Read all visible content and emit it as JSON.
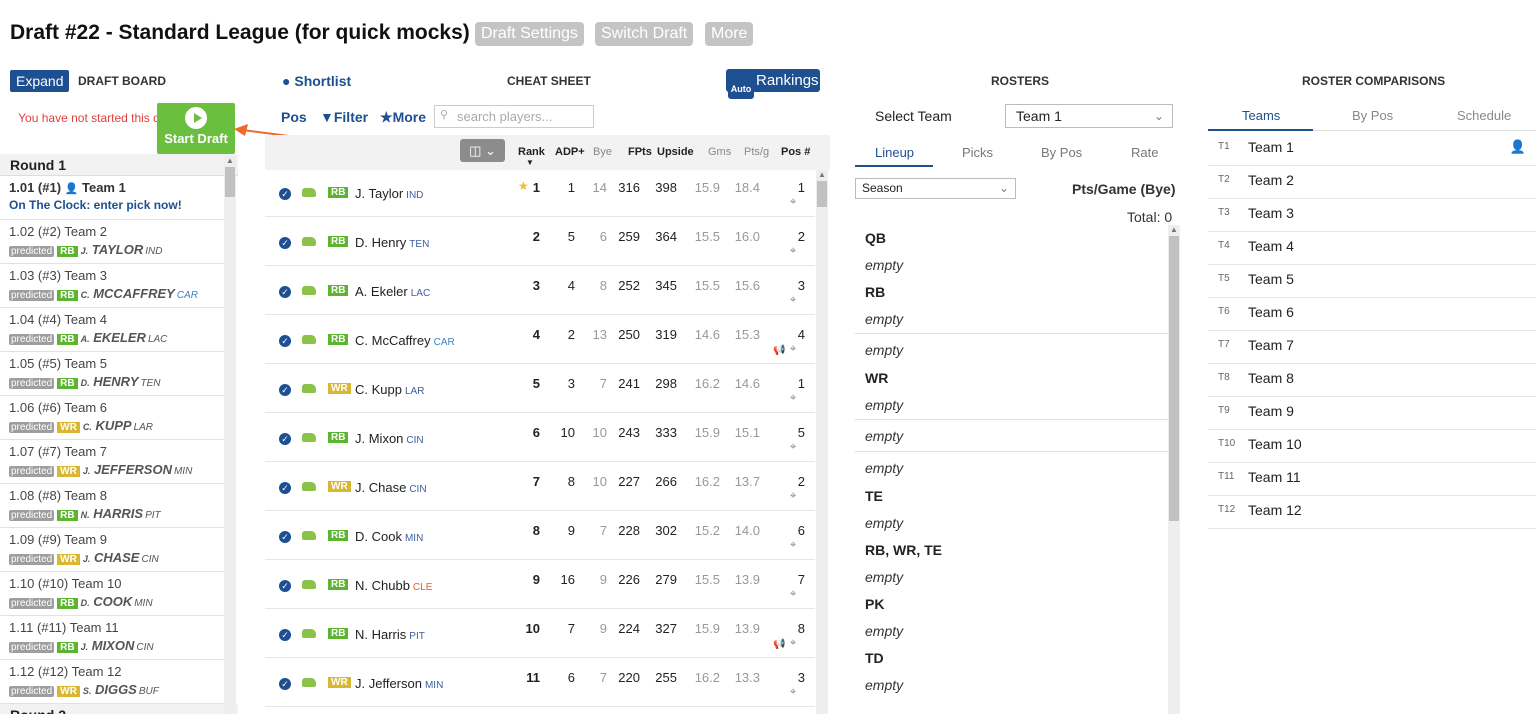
{
  "header": {
    "title": "Draft #22 - Standard League (for quick mocks)",
    "buttons": [
      "Draft Settings",
      "Switch Draft",
      "More"
    ]
  },
  "draft_board": {
    "expand_label": "Expand",
    "title": "DRAFT BOARD",
    "not_started": "You have not started this draft yet!",
    "start_label": "Start Draft",
    "round1_label": "Round 1",
    "round2_label": "Round 2",
    "first_pick": {
      "label": "1.01 (#1)",
      "team": "Team 1",
      "status": "On The Clock: enter pick now!"
    },
    "predicted_label": "predicted",
    "picks": [
      {
        "label": "1.02 (#2) Team 2",
        "pos": "RB",
        "init": "J.",
        "name": "TAYLOR",
        "team": "IND"
      },
      {
        "label": "1.03 (#3) Team 3",
        "pos": "RB",
        "init": "C.",
        "name": "MCCAFFREY",
        "team": "CAR"
      },
      {
        "label": "1.04 (#4) Team 4",
        "pos": "RB",
        "init": "A.",
        "name": "EKELER",
        "team": "LAC"
      },
      {
        "label": "1.05 (#5) Team 5",
        "pos": "RB",
        "init": "D.",
        "name": "HENRY",
        "team": "TEN"
      },
      {
        "label": "1.06 (#6) Team 6",
        "pos": "WR",
        "init": "C.",
        "name": "KUPP",
        "team": "LAR"
      },
      {
        "label": "1.07 (#7) Team 7",
        "pos": "WR",
        "init": "J.",
        "name": "JEFFERSON",
        "team": "MIN"
      },
      {
        "label": "1.08 (#8) Team 8",
        "pos": "RB",
        "init": "N.",
        "name": "HARRIS",
        "team": "PIT"
      },
      {
        "label": "1.09 (#9) Team 9",
        "pos": "WR",
        "init": "J.",
        "name": "CHASE",
        "team": "CIN"
      },
      {
        "label": "1.10 (#10) Team 10",
        "pos": "RB",
        "init": "D.",
        "name": "COOK",
        "team": "MIN"
      },
      {
        "label": "1.11 (#11) Team 11",
        "pos": "RB",
        "init": "J.",
        "name": "MIXON",
        "team": "CIN"
      },
      {
        "label": "1.12 (#12) Team 12",
        "pos": "WR",
        "init": "S.",
        "name": "DIGGS",
        "team": "BUF"
      }
    ]
  },
  "cheat_sheet": {
    "shortlist_label": "Shortlist",
    "title": "CHEAT SHEET",
    "rankings_label": "Rankings",
    "auto_label": "Auto",
    "pos_label": "Pos",
    "filter_label": "Filter",
    "more_label": "More",
    "search_placeholder": "search players...",
    "columns": [
      "Rank",
      "ADP+",
      "Bye",
      "FPts",
      "Upside",
      "Gms",
      "Pts/g",
      "Pos #"
    ],
    "players": [
      {
        "pos": "RB",
        "name": "J. Taylor",
        "team": "IND",
        "rank": "1",
        "adp": "1",
        "bye": "14",
        "fpts": "316",
        "upside": "398",
        "gms": "15.9",
        "ptsg": "18.4",
        "posn": "1",
        "star": true
      },
      {
        "pos": "RB",
        "name": "D. Henry",
        "team": "TEN",
        "rank": "2",
        "adp": "5",
        "bye": "6",
        "fpts": "259",
        "upside": "364",
        "gms": "15.5",
        "ptsg": "16.0",
        "posn": "2"
      },
      {
        "pos": "RB",
        "name": "A. Ekeler",
        "team": "LAC",
        "rank": "3",
        "adp": "4",
        "bye": "8",
        "fpts": "252",
        "upside": "345",
        "gms": "15.5",
        "ptsg": "15.6",
        "posn": "3"
      },
      {
        "pos": "RB",
        "name": "C. McCaffrey",
        "team": "CAR",
        "rank": "4",
        "adp": "2",
        "bye": "13",
        "fpts": "250",
        "upside": "319",
        "gms": "14.6",
        "ptsg": "15.3",
        "posn": "4",
        "news": true
      },
      {
        "pos": "WR",
        "name": "C. Kupp",
        "team": "LAR",
        "rank": "5",
        "adp": "3",
        "bye": "7",
        "fpts": "241",
        "upside": "298",
        "gms": "16.2",
        "ptsg": "14.6",
        "posn": "1"
      },
      {
        "pos": "RB",
        "name": "J. Mixon",
        "team": "CIN",
        "rank": "6",
        "adp": "10",
        "bye": "10",
        "fpts": "243",
        "upside": "333",
        "gms": "15.9",
        "ptsg": "15.1",
        "posn": "5"
      },
      {
        "pos": "WR",
        "name": "J. Chase",
        "team": "CIN",
        "rank": "7",
        "adp": "8",
        "bye": "10",
        "fpts": "227",
        "upside": "266",
        "gms": "16.2",
        "ptsg": "13.7",
        "posn": "2"
      },
      {
        "pos": "RB",
        "name": "D. Cook",
        "team": "MIN",
        "rank": "8",
        "adp": "9",
        "bye": "7",
        "fpts": "228",
        "upside": "302",
        "gms": "15.2",
        "ptsg": "14.0",
        "posn": "6"
      },
      {
        "pos": "RB",
        "name": "N. Chubb",
        "team": "CLE",
        "rank": "9",
        "adp": "16",
        "bye": "9",
        "fpts": "226",
        "upside": "279",
        "gms": "15.5",
        "ptsg": "13.9",
        "posn": "7"
      },
      {
        "pos": "RB",
        "name": "N. Harris",
        "team": "PIT",
        "rank": "10",
        "adp": "7",
        "bye": "9",
        "fpts": "224",
        "upside": "327",
        "gms": "15.9",
        "ptsg": "13.9",
        "posn": "8",
        "news": true
      },
      {
        "pos": "WR",
        "name": "J. Jefferson",
        "team": "MIN",
        "rank": "11",
        "adp": "6",
        "bye": "7",
        "fpts": "220",
        "upside": "255",
        "gms": "16.2",
        "ptsg": "13.3",
        "posn": "3"
      }
    ]
  },
  "rosters": {
    "title": "ROSTERS",
    "select_label": "Select Team",
    "selected_team": "Team 1",
    "tabs": [
      "Lineup",
      "Picks",
      "By Pos",
      "Rate"
    ],
    "season_value": "Season",
    "pts_label": "Pts/Game (Bye)",
    "total_label": "Total: 0",
    "slots": [
      {
        "t": "h",
        "v": "QB"
      },
      {
        "t": "e",
        "v": "empty"
      },
      {
        "t": "h",
        "v": "RB"
      },
      {
        "t": "e",
        "v": "empty"
      },
      {
        "t": "s",
        "v": "empty"
      },
      {
        "t": "h",
        "v": "WR"
      },
      {
        "t": "e",
        "v": "empty"
      },
      {
        "t": "s",
        "v": "empty"
      },
      {
        "t": "s",
        "v": "empty"
      },
      {
        "t": "h",
        "v": "TE"
      },
      {
        "t": "e",
        "v": "empty"
      },
      {
        "t": "h",
        "v": "RB, WR, TE"
      },
      {
        "t": "e",
        "v": "empty"
      },
      {
        "t": "h",
        "v": "PK"
      },
      {
        "t": "e",
        "v": "empty"
      },
      {
        "t": "h",
        "v": "TD"
      },
      {
        "t": "e",
        "v": "empty"
      }
    ]
  },
  "comparisons": {
    "title": "ROSTER COMPARISONS",
    "tabs": [
      "Teams",
      "By Pos",
      "Schedule"
    ],
    "teams": [
      {
        "id": "T1",
        "name": "Team 1"
      },
      {
        "id": "T2",
        "name": "Team 2"
      },
      {
        "id": "T3",
        "name": "Team 3"
      },
      {
        "id": "T4",
        "name": "Team 4"
      },
      {
        "id": "T5",
        "name": "Team 5"
      },
      {
        "id": "T6",
        "name": "Team 6"
      },
      {
        "id": "T7",
        "name": "Team 7"
      },
      {
        "id": "T8",
        "name": "Team 8"
      },
      {
        "id": "T9",
        "name": "Team 9"
      },
      {
        "id": "T10",
        "name": "Team 10"
      },
      {
        "id": "T11",
        "name": "Team 11"
      },
      {
        "id": "T12",
        "name": "Team 12"
      }
    ]
  }
}
